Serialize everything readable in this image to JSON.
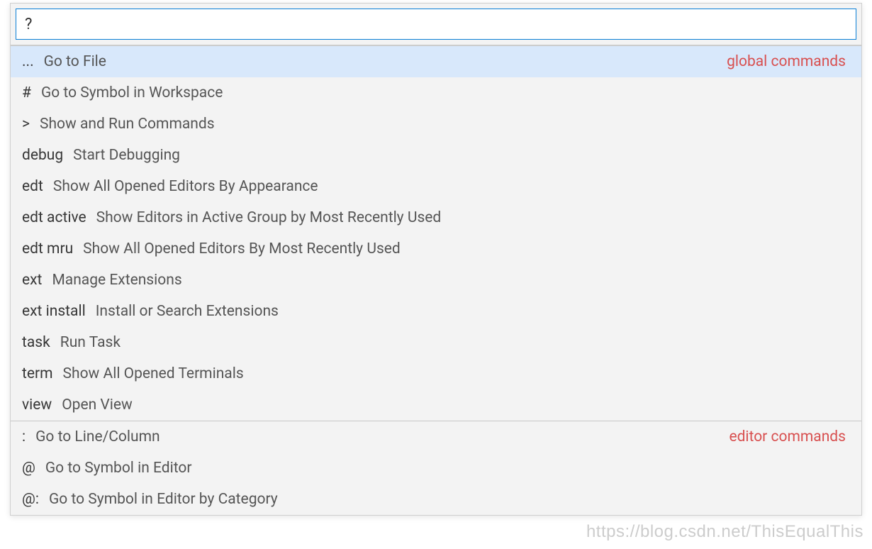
{
  "input": {
    "value": "?"
  },
  "groups": {
    "global": "global commands",
    "editor": "editor commands"
  },
  "globalItems": [
    {
      "prefix": "...",
      "label": "Go to File"
    },
    {
      "prefix": "#",
      "label": "Go to Symbol in Workspace"
    },
    {
      "prefix": ">",
      "label": "Show and Run Commands"
    },
    {
      "prefix": "debug",
      "label": "Start Debugging"
    },
    {
      "prefix": "edt",
      "label": "Show All Opened Editors By Appearance"
    },
    {
      "prefix": "edt active",
      "label": "Show Editors in Active Group by Most Recently Used"
    },
    {
      "prefix": "edt mru",
      "label": "Show All Opened Editors By Most Recently Used"
    },
    {
      "prefix": "ext",
      "label": "Manage Extensions"
    },
    {
      "prefix": "ext install",
      "label": "Install or Search Extensions"
    },
    {
      "prefix": "task",
      "label": "Run Task"
    },
    {
      "prefix": "term",
      "label": "Show All Opened Terminals"
    },
    {
      "prefix": "view",
      "label": "Open View"
    }
  ],
  "editorItems": [
    {
      "prefix": ":",
      "label": "Go to Line/Column"
    },
    {
      "prefix": "@",
      "label": "Go to Symbol in Editor"
    },
    {
      "prefix": "@:",
      "label": "Go to Symbol in Editor by Category"
    }
  ],
  "watermark": "https://blog.csdn.net/ThisEqualThis"
}
